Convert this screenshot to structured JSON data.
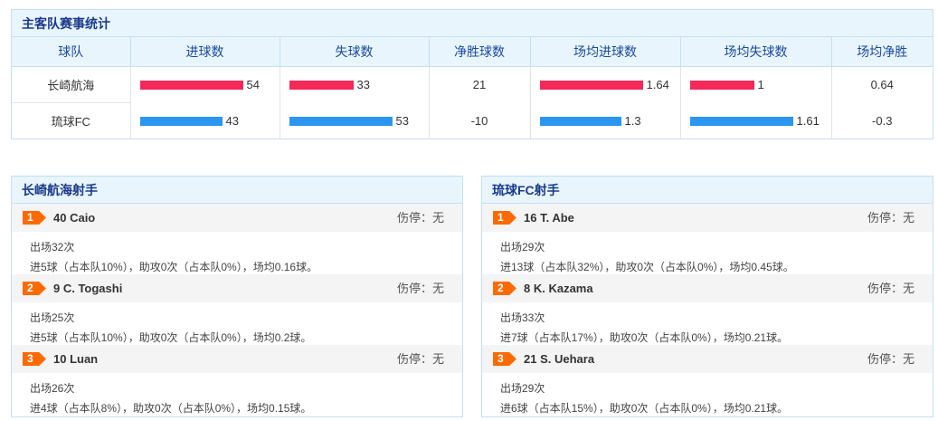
{
  "stats": {
    "title": "主客队赛事统计",
    "headers": [
      "球队",
      "进球数",
      "失球数",
      "净胜球数",
      "场均进球数",
      "场均失球数",
      "场均净胜"
    ],
    "colors": {
      "home": "#f5285a",
      "away": "#2a96f0"
    },
    "rows": [
      {
        "team": "长崎航海",
        "goals": "54",
        "conceded": "33",
        "diff": "21",
        "avg_goals": "1.64",
        "avg_conceded": "1",
        "avg_diff": "0.64"
      },
      {
        "team": "琉球FC",
        "goals": "43",
        "conceded": "53",
        "diff": "-10",
        "avg_goals": "1.3",
        "avg_conceded": "1.61",
        "avg_diff": "-0.3"
      }
    ]
  },
  "home_scorers": {
    "title": "长崎航海射手",
    "players": [
      {
        "rank": "1",
        "name": "40 Caio",
        "injury": "伤停：无",
        "apps": "出场32次",
        "line": "进5球（占本队10%），助攻0次（占本队0%），场均0.16球。"
      },
      {
        "rank": "2",
        "name": "9 C. Togashi",
        "injury": "伤停：无",
        "apps": "出场25次",
        "line": "进5球（占本队10%），助攻0次（占本队0%），场均0.2球。"
      },
      {
        "rank": "3",
        "name": "10 Luan",
        "injury": "伤停：无",
        "apps": "出场26次",
        "line": "进4球（占本队8%），助攻0次（占本队0%），场均0.15球。"
      }
    ]
  },
  "away_scorers": {
    "title": "琉球FC射手",
    "players": [
      {
        "rank": "1",
        "name": "16 T. Abe",
        "injury": "伤停：无",
        "apps": "出场29次",
        "line": "进13球（占本队32%），助攻0次（占本队0%），场均0.45球。"
      },
      {
        "rank": "2",
        "name": "8 K. Kazama",
        "injury": "伤停：无",
        "apps": "出场33次",
        "line": "进7球（占本队17%），助攻0次（占本队0%），场均0.21球。"
      },
      {
        "rank": "3",
        "name": "21 S. Uehara",
        "injury": "伤停：无",
        "apps": "出场29次",
        "line": "进6球（占本队15%），助攻0次（占本队0%），场均0.21球。"
      }
    ]
  }
}
